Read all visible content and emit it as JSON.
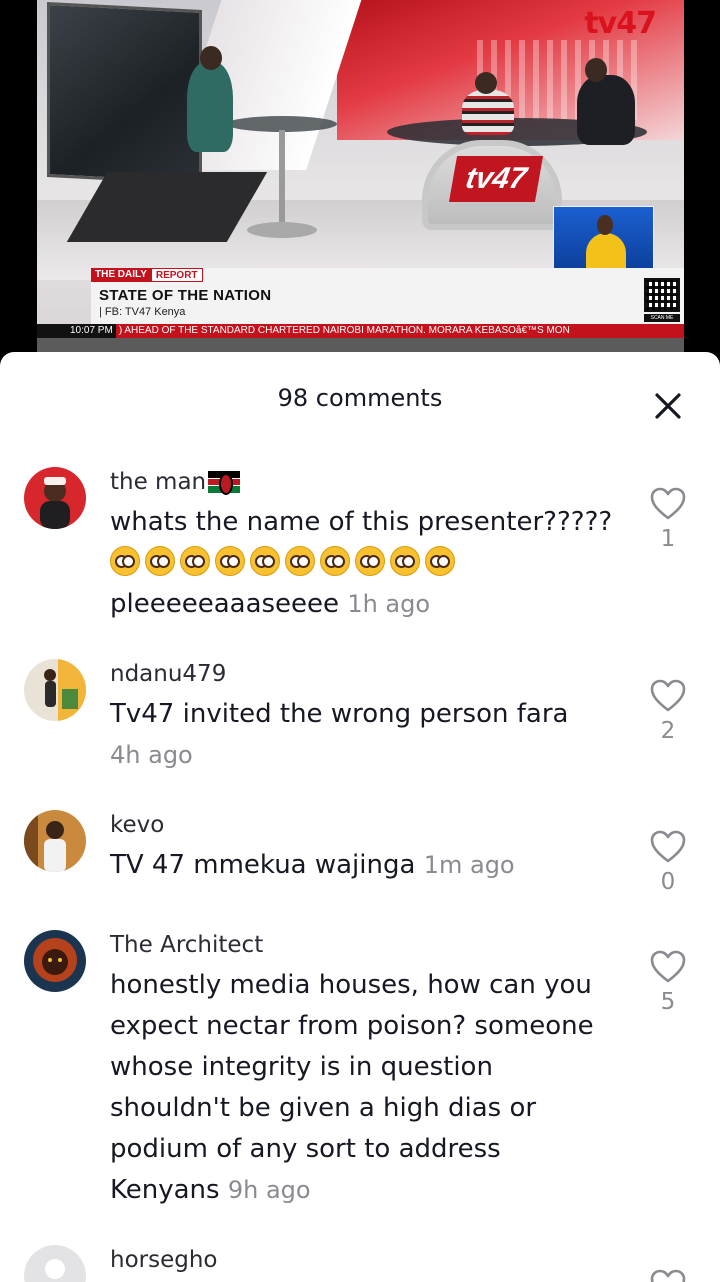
{
  "video": {
    "brand_logo": "tv47",
    "desk_logo": "tv47",
    "lower_third": {
      "tag_1": "THE DAILY",
      "tag_2": "REPORT",
      "title": "STATE OF THE NATION",
      "subtitle": "| FB: TV47 Kenya",
      "scan_label": "SCAN ME"
    },
    "ticker": {
      "time": "10:07 PM",
      "text": ") AHEAD OF THE STANDARD CHARTERED NAIROBI MARATHON.      MORARA KEBASOâ€™S MON"
    }
  },
  "sheet": {
    "comment_count_label": "98 comments",
    "close_icon": "close-icon"
  },
  "comments": [
    {
      "username": "the man",
      "text": "whats the name of this presenter?????",
      "text_after_emoji": "pleeeeeaaaseeee",
      "time": "1h ago",
      "likes": "1"
    },
    {
      "username": "ndanu479",
      "text": "Tv47 invited the wrong person fara",
      "time": "4h ago",
      "likes": "2"
    },
    {
      "username": "kevo",
      "text": "TV 47 mmekua wajinga",
      "time": "1m ago",
      "likes": "0"
    },
    {
      "username": "The Architect",
      "text": "honestly media houses, how can you expect nectar from poison? someone whose integrity is in question shouldn't be given a high dias or podium of any sort to address Kenyans",
      "time": "9h ago",
      "likes": "5"
    },
    {
      "username": "horsegho",
      "text": "",
      "time": "",
      "likes": ""
    }
  ],
  "colors": {
    "accent_red": "#c4121c",
    "text_primary": "#161823",
    "text_secondary": "#8a8b91"
  }
}
